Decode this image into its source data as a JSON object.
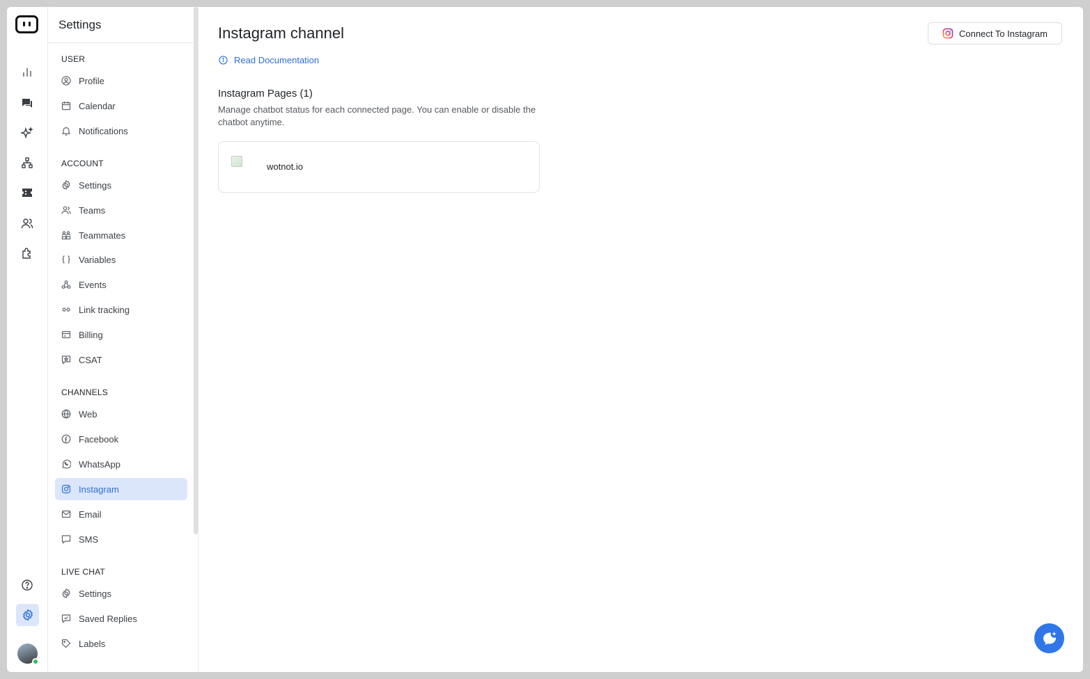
{
  "sidebar": {
    "title": "Settings",
    "sections": [
      {
        "label": "USER",
        "items": [
          {
            "label": "Profile",
            "icon": "user-circle-icon"
          },
          {
            "label": "Calendar",
            "icon": "calendar-icon"
          },
          {
            "label": "Notifications",
            "icon": "bell-icon"
          }
        ]
      },
      {
        "label": "ACCOUNT",
        "items": [
          {
            "label": "Settings",
            "icon": "gear-icon"
          },
          {
            "label": "Teams",
            "icon": "users-icon"
          },
          {
            "label": "Teammates",
            "icon": "grid-people-icon"
          },
          {
            "label": "Variables",
            "icon": "braces-icon"
          },
          {
            "label": "Events",
            "icon": "webhook-icon"
          },
          {
            "label": "Link tracking",
            "icon": "link-icon"
          },
          {
            "label": "Billing",
            "icon": "card-icon"
          },
          {
            "label": "CSAT",
            "icon": "star-message-icon"
          }
        ]
      },
      {
        "label": "CHANNELS",
        "items": [
          {
            "label": "Web",
            "icon": "globe-icon"
          },
          {
            "label": "Facebook",
            "icon": "facebook-icon"
          },
          {
            "label": "WhatsApp",
            "icon": "whatsapp-icon"
          },
          {
            "label": "Instagram",
            "icon": "instagram-icon",
            "active": true
          },
          {
            "label": "Email",
            "icon": "mail-icon"
          },
          {
            "label": "SMS",
            "icon": "message-square-icon"
          }
        ]
      },
      {
        "label": "LIVE CHAT",
        "items": [
          {
            "label": "Settings",
            "icon": "gear-icon"
          },
          {
            "label": "Saved Replies",
            "icon": "saved-reply-icon"
          },
          {
            "label": "Labels",
            "icon": "tag-icon"
          }
        ]
      }
    ]
  },
  "main": {
    "title": "Instagram channel",
    "doc_link": "Read Documentation",
    "connect_button": "Connect To Instagram",
    "pages_title": "Instagram Pages (1)",
    "pages_description": "Manage chatbot status for each connected page. You can enable or disable the chatbot anytime.",
    "pages": [
      {
        "name": "wotnot.io"
      }
    ]
  },
  "colors": {
    "accent": "#2f77e8",
    "active_bg": "#dbe6fb",
    "link": "#2f6fd6"
  }
}
